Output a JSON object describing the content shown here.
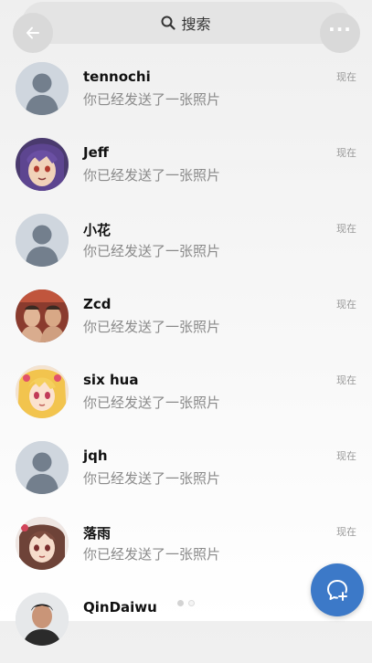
{
  "search": {
    "label": "搜索",
    "icon": "search-icon"
  },
  "header": {
    "back_icon": "back-arrow-icon",
    "more_icon": "more-icon",
    "more_label": "···"
  },
  "conversations": [
    {
      "name": "tennochi",
      "message": "你已经发送了一张照片",
      "time": "现在",
      "avatar": "default-avatar"
    },
    {
      "name": "Jeff",
      "message": "你已经发送了一张照片",
      "time": "现在",
      "avatar": "anime-purple-hair-avatar"
    },
    {
      "name": "小花",
      "message": "你已经发送了一张照片",
      "time": "现在",
      "avatar": "default-avatar"
    },
    {
      "name": "Zcd",
      "message": "你已经发送了一张照片",
      "time": "现在",
      "avatar": "photo-avatar"
    },
    {
      "name": "six hua",
      "message": "你已经发送了一张照片",
      "time": "现在",
      "avatar": "anime-blonde-avatar"
    },
    {
      "name": "jqh",
      "message": "你已经发送了一张照片",
      "time": "现在",
      "avatar": "default-avatar"
    },
    {
      "name": "落雨",
      "message": "你已经发送了一张照片",
      "time": "现在",
      "avatar": "anime-brown-hair-avatar"
    },
    {
      "name": "QinDaiwu",
      "message": "",
      "time": "",
      "avatar": "photo-person-avatar"
    }
  ],
  "pager": {
    "pages": 2,
    "current": 2
  },
  "fab": {
    "icon": "new-chat-icon"
  },
  "colors": {
    "accent": "#3c79c8",
    "secondary_text": "#8a8a8a",
    "avatar_default": "#cfd6de"
  }
}
